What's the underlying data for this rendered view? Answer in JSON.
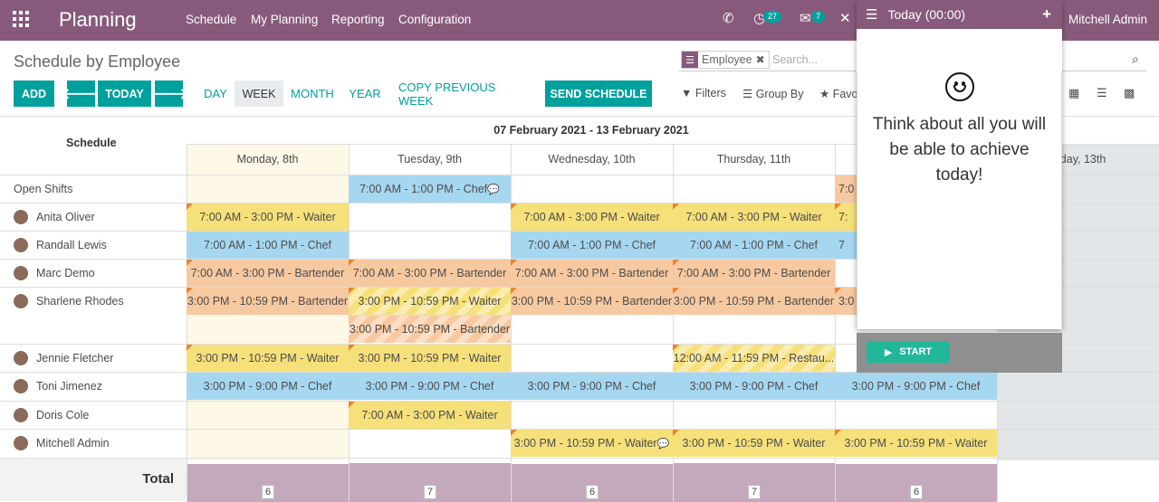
{
  "navbar": {
    "brand": "Planning",
    "menu": [
      "Schedule",
      "My Planning",
      "Reporting",
      "Configuration"
    ],
    "activity_badge": "27",
    "messages_badge": "7",
    "user": "Mitchell Admin"
  },
  "view": {
    "title": "Schedule by Employee",
    "search_facet_label": "Employee",
    "search_placeholder": "Search...",
    "buttons": {
      "add": "ADD",
      "prev_icon": "arrow-left-icon",
      "today": "TODAY",
      "next_icon": "arrow-right-icon",
      "day": "DAY",
      "week": "WEEK",
      "month": "MONTH",
      "year": "YEAR",
      "copy_previous": "COPY PREVIOUS WEEK",
      "send_schedule": "SEND SCHEDULE"
    },
    "filters": "Filters",
    "group_by": "Group By",
    "favorites": "Favo"
  },
  "schedule": {
    "header_label": "Schedule",
    "range": "07 February 2021 - 13 February 2021",
    "days": [
      "Monday, 8th",
      "Tuesday, 9th",
      "Wednesday, 10th",
      "Thursday, 11th",
      "",
      "urday, 13th"
    ],
    "rows": [
      {
        "name": "Open Shifts"
      },
      {
        "name": "Anita Oliver"
      },
      {
        "name": "Randall Lewis"
      },
      {
        "name": "Marc Demo"
      },
      {
        "name": "Sharlene Rhodes"
      },
      {
        "name": "Jennie Fletcher"
      },
      {
        "name": "Toni Jimenez"
      },
      {
        "name": "Doris Cole"
      },
      {
        "name": "Mitchell Admin"
      }
    ],
    "shifts": [
      {
        "row": 0,
        "day": 1,
        "text": "7:00 AM - 1:00 PM - Chef",
        "color": "blue",
        "comment": true
      },
      {
        "row": 0,
        "day": 4,
        "text": "7:0",
        "color": "orange"
      },
      {
        "row": 1,
        "day": 0,
        "text": "7:00 AM - 3:00 PM - Waiter",
        "color": "yellow"
      },
      {
        "row": 1,
        "day": 2,
        "text": "7:00 AM - 3:00 PM - Waiter",
        "color": "yellow"
      },
      {
        "row": 1,
        "day": 3,
        "text": "7:00 AM - 3:00 PM - Waiter",
        "color": "yellow"
      },
      {
        "row": 1,
        "day": 4,
        "text": "7:",
        "color": "yellow"
      },
      {
        "row": 2,
        "day": 0,
        "text": "7:00 AM - 1:00 PM - Chef",
        "color": "blue"
      },
      {
        "row": 2,
        "day": 2,
        "text": "7:00 AM - 1:00 PM - Chef",
        "color": "blue"
      },
      {
        "row": 2,
        "day": 3,
        "text": "7:00 AM - 1:00 PM - Chef",
        "color": "blue"
      },
      {
        "row": 2,
        "day": 4,
        "text": "7",
        "color": "blue"
      },
      {
        "row": 3,
        "day": 0,
        "text": "7:00 AM - 3:00 PM - Bartender",
        "color": "orange"
      },
      {
        "row": 3,
        "day": 1,
        "text": "7:00 AM - 3:00 PM - Bartender",
        "color": "orange"
      },
      {
        "row": 3,
        "day": 2,
        "text": "7:00 AM - 3:00 PM - Bartender",
        "color": "orange"
      },
      {
        "row": 3,
        "day": 3,
        "text": "7:00 AM - 3:00 PM - Bartender",
        "color": "orange"
      },
      {
        "row": 4,
        "day": 0,
        "text": "3:00 PM - 10:59 PM - Bartender",
        "color": "orange"
      },
      {
        "row": 4,
        "day": 1,
        "text": "3:00 PM - 10:59 PM - Waiter",
        "color": "stripe"
      },
      {
        "row": 4,
        "day": 2,
        "text": "3:00 PM - 10:59 PM - Bartender",
        "color": "orange"
      },
      {
        "row": 4,
        "day": 3,
        "text": "3:00 PM - 10:59 PM - Bartender",
        "color": "orange"
      },
      {
        "row": 4,
        "day": 4,
        "text": "3:0",
        "color": "orange"
      },
      {
        "row": 4.5,
        "day": 1,
        "text": "3:00 PM - 10:59 PM - Bartender",
        "color": "stripeo"
      },
      {
        "row": 5,
        "day": 0,
        "text": "3:00 PM - 10:59 PM - Waiter",
        "color": "yellow"
      },
      {
        "row": 5,
        "day": 1,
        "text": "3:00 PM - 10:59 PM - Waiter",
        "color": "yellow"
      },
      {
        "row": 5,
        "day": 3,
        "text": "12:00 AM - 11:59 PM - Restau...",
        "color": "stripe"
      },
      {
        "row": 6,
        "day": 0,
        "text": "3:00 PM - 9:00 PM - Chef",
        "color": "blue"
      },
      {
        "row": 6,
        "day": 1,
        "text": "3:00 PM - 9:00 PM - Chef",
        "color": "blue"
      },
      {
        "row": 6,
        "day": 2,
        "text": "3:00 PM - 9:00 PM - Chef",
        "color": "blue"
      },
      {
        "row": 6,
        "day": 3,
        "text": "3:00 PM - 9:00 PM - Chef",
        "color": "blue"
      },
      {
        "row": 6,
        "day": 4,
        "text": "3:00 PM - 9:00 PM - Chef",
        "color": "blue"
      },
      {
        "row": 7,
        "day": 1,
        "text": "7:00 AM - 3:00 PM - Waiter",
        "color": "yellow"
      },
      {
        "row": 8,
        "day": 2,
        "text": "3:00 PM - 10:59 PM - Waiter",
        "color": "yellow",
        "comment": true
      },
      {
        "row": 8,
        "day": 3,
        "text": "3:00 PM - 10:59 PM - Waiter",
        "color": "yellow"
      },
      {
        "row": 8,
        "day": 4,
        "text": "3:00 PM - 10:59 PM - Waiter",
        "color": "yellow"
      }
    ],
    "total_label": "Total",
    "totals": [
      "6",
      "7",
      "6",
      "7",
      "6"
    ]
  },
  "timer_popup": {
    "title": "Today (00:00)",
    "add_icon": "plus-icon",
    "message": "Think about all you will be able to achieve today!",
    "start": "START"
  },
  "colors": {
    "brand": "#875a7b",
    "accent": "#00a09d"
  }
}
